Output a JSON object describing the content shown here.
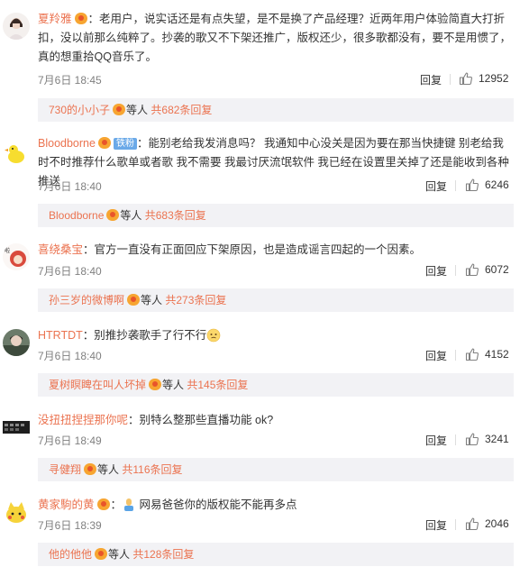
{
  "comments": [
    {
      "user": "夏羚雅",
      "colon": "：",
      "text": "老用户，说实话还是有点失望，是不是换了产品经理？近两年用户体验简直大打折扣，没以前那么纯粹了。抄袭的歌又不下架还推广，版权还少，很多歌都没有，要不是用惯了，真的想重拾QQ音乐了。",
      "time": "7月6日 18:45",
      "reply_label": "回复",
      "likes": "12952",
      "sub_user": "730的小小子",
      "sub_mid": "等人",
      "sub_count": "共682条回复"
    },
    {
      "user": "Bloodborne",
      "tag": "铁粉",
      "colon": "：",
      "text": "能别老给我发消息吗？ 我通知中心没关是因为要在那当快捷键 别老给我时不时推荐什么歌单或者歌 我不需要 我最讨厌流氓软件 我已经在设置里关掉了还是能收到各种推送",
      "time": "7月6日 18:40",
      "reply_label": "回复",
      "likes": "6246",
      "sub_user": "Bloodborne",
      "sub_mid": "等人",
      "sub_count": "共683条回复"
    },
    {
      "user": "喜绕桑宝",
      "colon": "：",
      "text": "官方一直没有正面回应下架原因，也是造成谣言四起的一个因素。",
      "time": "7月6日 18:40",
      "reply_label": "回复",
      "likes": "6072",
      "sub_user": "孙三岁的微博啊",
      "sub_mid": "等人",
      "sub_count": "共273条回复"
    },
    {
      "user": "HTRTDT",
      "colon": "：",
      "text": "别推抄袭歌手了行不行",
      "time": "7月6日 18:40",
      "reply_label": "回复",
      "likes": "4152",
      "sub_user": "夏树瞑睥在叫人坏掉",
      "sub_mid": "等人",
      "sub_count": "共145条回复"
    },
    {
      "user": "没扭扭捏捏那你呢",
      "colon": "：",
      "text": "别特么整那些直播功能 ok?",
      "time": "7月6日 18:49",
      "reply_label": "回复",
      "likes": "3241",
      "sub_user": "寻健翔",
      "sub_mid": "等人",
      "sub_count": "共116条回复"
    },
    {
      "user": "黄家駒的黄",
      "colon": "：",
      "text": "网易爸爸你的版权能不能再多点",
      "time": "7月6日 18:39",
      "reply_label": "回复",
      "likes": "2046",
      "sub_user": "他的他他",
      "sub_mid": "等人",
      "sub_count": "共128条回复"
    }
  ],
  "colors": {
    "accent": "#eb7350",
    "meta": "#808080",
    "subbar": "#f2f2f5",
    "tag": "#6aa9e8"
  }
}
